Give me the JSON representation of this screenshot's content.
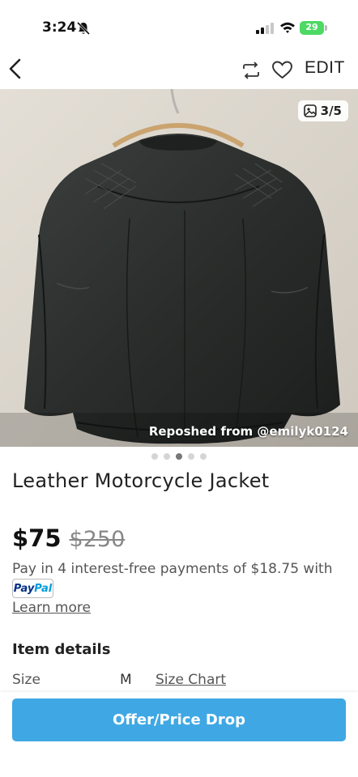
{
  "status_bar": {
    "time": "3:24",
    "battery": "29"
  },
  "nav": {
    "edit_label": "EDIT"
  },
  "photo": {
    "counter": "3/5",
    "repost_credit": "Reposhed from @emilyk0124",
    "dots": 5,
    "active_dot": 3
  },
  "listing": {
    "title": "Leather Motorcycle Jacket",
    "price": "$75",
    "original_price": "$250",
    "installment_text": "Pay in 4 interest-free payments of $18.75 with",
    "paypal_part1": "Pay",
    "paypal_part2": "Pal",
    "learn_more": "Learn more"
  },
  "details": {
    "heading": "Item details",
    "size_label": "Size",
    "size_value": "M",
    "size_chart": "Size Chart"
  },
  "actions": {
    "offer_label": "Offer/Price Drop"
  },
  "colors": {
    "accent": "#3fa8e4",
    "battery": "#4cd964"
  }
}
